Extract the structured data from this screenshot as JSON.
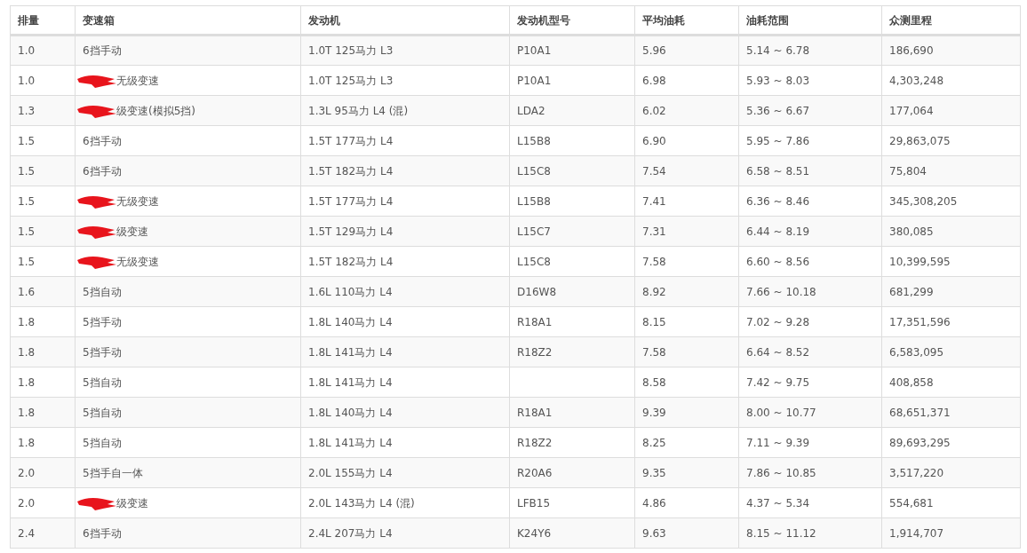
{
  "table": {
    "columns": [
      "排量",
      "变速箱",
      "发动机",
      "发动机型号",
      "平均油耗",
      "油耗范围",
      "众测里程"
    ],
    "rows": [
      {
        "cells": [
          "1.0",
          "6挡手动",
          "1.0T 125马力 L3",
          "P10A1",
          "5.96",
          "5.14 ~ 6.78",
          "186,690"
        ],
        "redacted": false
      },
      {
        "cells": [
          "1.0",
          "无级变速",
          "1.0T 125马力 L3",
          "P10A1",
          "6.98",
          "5.93 ~ 8.03",
          "4,303,248"
        ],
        "redacted": true
      },
      {
        "cells": [
          "1.3",
          "级变速(模拟5挡)",
          "1.3L 95马力 L4 (混)",
          "LDA2",
          "6.02",
          "5.36 ~ 6.67",
          "177,064"
        ],
        "redacted": true
      },
      {
        "cells": [
          "1.5",
          "6挡手动",
          "1.5T 177马力 L4",
          "L15B8",
          "6.90",
          "5.95 ~ 7.86",
          "29,863,075"
        ],
        "redacted": false
      },
      {
        "cells": [
          "1.5",
          "6挡手动",
          "1.5T 182马力 L4",
          "L15C8",
          "7.54",
          "6.58 ~ 8.51",
          "75,804"
        ],
        "redacted": false
      },
      {
        "cells": [
          "1.5",
          "无级变速",
          "1.5T 177马力 L4",
          "L15B8",
          "7.41",
          "6.36 ~ 8.46",
          "345,308,205"
        ],
        "redacted": true
      },
      {
        "cells": [
          "1.5",
          "级变速",
          "1.5T 129马力 L4",
          "L15C7",
          "7.31",
          "6.44 ~ 8.19",
          "380,085"
        ],
        "redacted": true
      },
      {
        "cells": [
          "1.5",
          "无级变速",
          "1.5T 182马力 L4",
          "L15C8",
          "7.58",
          "6.60 ~ 8.56",
          "10,399,595"
        ],
        "redacted": true
      },
      {
        "cells": [
          "1.6",
          "5挡自动",
          "1.6L 110马力 L4",
          "D16W8",
          "8.92",
          "7.66 ~ 10.18",
          "681,299"
        ],
        "redacted": false
      },
      {
        "cells": [
          "1.8",
          "5挡手动",
          "1.8L 140马力 L4",
          "R18A1",
          "8.15",
          "7.02 ~ 9.28",
          "17,351,596"
        ],
        "redacted": false
      },
      {
        "cells": [
          "1.8",
          "5挡手动",
          "1.8L 141马力 L4",
          "R18Z2",
          "7.58",
          "6.64 ~ 8.52",
          "6,583,095"
        ],
        "redacted": false
      },
      {
        "cells": [
          "1.8",
          "5挡自动",
          "1.8L 141马力 L4",
          "",
          "8.58",
          "7.42 ~ 9.75",
          "408,858"
        ],
        "redacted": false
      },
      {
        "cells": [
          "1.8",
          "5挡自动",
          "1.8L 140马力 L4",
          "R18A1",
          "9.39",
          "8.00 ~ 10.77",
          "68,651,371"
        ],
        "redacted": false
      },
      {
        "cells": [
          "1.8",
          "5挡自动",
          "1.8L 141马力 L4",
          "R18Z2",
          "8.25",
          "7.11 ~ 9.39",
          "89,693,295"
        ],
        "redacted": false
      },
      {
        "cells": [
          "2.0",
          "5挡手自一体",
          "2.0L 155马力 L4",
          "R20A6",
          "9.35",
          "7.86 ~ 10.85",
          "3,517,220"
        ],
        "redacted": false
      },
      {
        "cells": [
          "2.0",
          "级变速",
          "2.0L 143马力 L4 (混)",
          "LFB15",
          "4.86",
          "4.37 ~ 5.34",
          "554,681"
        ],
        "redacted": true
      },
      {
        "cells": [
          "2.4",
          "6挡手动",
          "2.4L 207马力 L4",
          "K24Y6",
          "9.63",
          "8.15 ~ 11.12",
          "1,914,707"
        ],
        "redacted": false
      }
    ]
  }
}
